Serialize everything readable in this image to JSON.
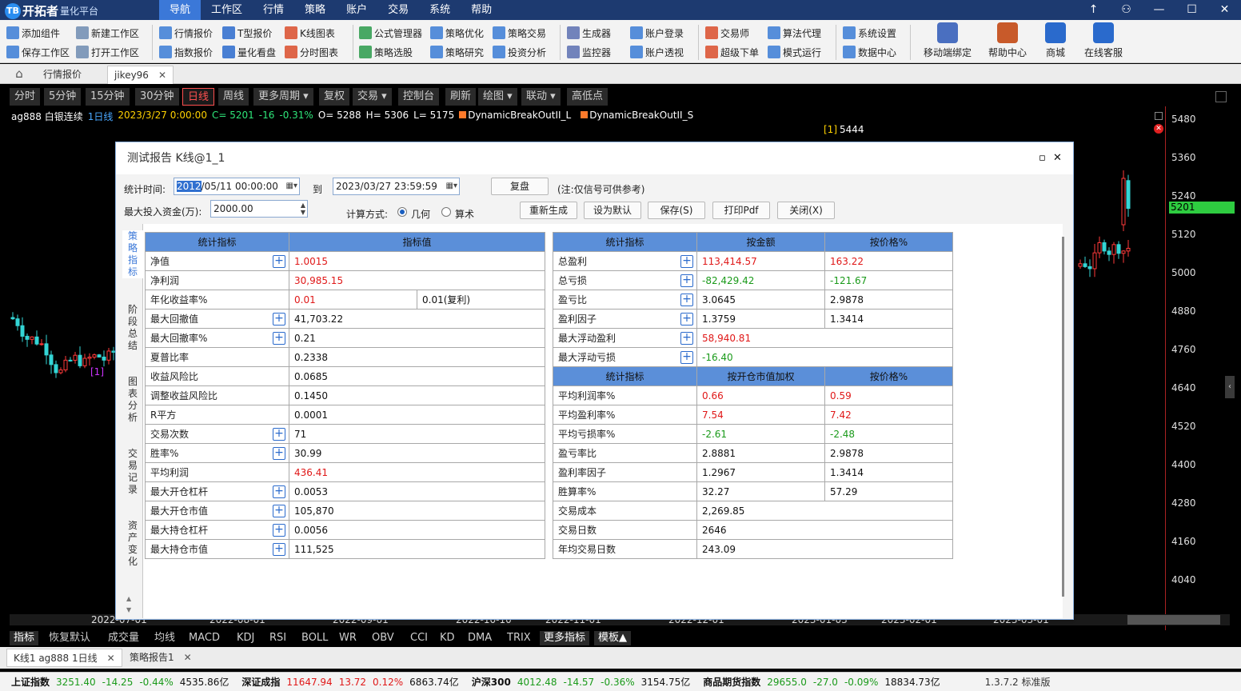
{
  "app": {
    "logo_text": "开拓者",
    "logo_sub": "量化平台",
    "logo_badge": "TB",
    "menu": [
      "导航",
      "工作区",
      "行情",
      "策略",
      "账户",
      "交易",
      "系统",
      "帮助"
    ],
    "menu_active": 0,
    "window_controls": [
      "↑",
      "⚇",
      "—",
      "☐",
      "✕"
    ]
  },
  "toolbar": {
    "groups": [
      [
        "添加组件",
        "保存工作区"
      ],
      [
        "新建工作区",
        "打开工作区"
      ],
      [
        "行情报价",
        "指数报价"
      ],
      [
        "T型报价",
        "量化看盘"
      ],
      [
        "K线图表",
        "分时图表"
      ],
      [
        "公式管理器",
        "策略选股"
      ],
      [
        "策略优化",
        "策略研究"
      ],
      [
        "策略交易",
        "投资分析"
      ],
      [
        "生成器",
        "监控器"
      ],
      [
        "账户登录",
        "账户透视"
      ],
      [
        "交易师",
        "超级下单"
      ],
      [
        "算法代理",
        "模式运行"
      ],
      [
        "系统设置",
        "数据中心"
      ]
    ],
    "big": [
      "移动端绑定",
      "帮助中心",
      "商城",
      "在线客服"
    ]
  },
  "tabs": [
    {
      "label": "行情报价"
    },
    {
      "label": "jikey96",
      "close": "✕"
    }
  ],
  "periods": [
    "分时",
    "5分钟",
    "15分钟",
    "30分钟",
    "日线",
    "周线",
    "更多周期 ▾",
    "复权",
    "交易 ▾",
    "控制台",
    "刷新",
    "绘图 ▾",
    "联动 ▾",
    "高低点"
  ],
  "period_selected": 4,
  "chart": {
    "symbol": "ag888 白银连续",
    "period": "1日线",
    "date": "2023/3/27 0:00:00",
    "close": "C= 5201",
    "change": "-16",
    "pct": "-0.31%",
    "open": "O= 5288",
    "high": "H= 5306",
    "low": "L= 5175",
    "ind1": "DynamicBreakOutII_L",
    "ind2": "DynamicBreakOutII_S",
    "marker_top": "[1]",
    "marker_top_val": "5444",
    "marker_left": "[1]",
    "price_ticks": [
      "5480",
      "5360",
      "5240",
      "5120",
      "5000",
      "4880",
      "4760",
      "4640",
      "4520",
      "4400",
      "4280",
      "4160",
      "4040"
    ],
    "current_price": "5201",
    "dates": [
      "2022-07-01",
      "2022-08-01",
      "2022-09-01",
      "2022-10-10",
      "2022-11-01",
      "2022-12-01",
      "2023-01-03",
      "2023-02-01",
      "2023-03-01"
    ],
    "colors": {
      "up": "#ff3a3a",
      "down": "#33d6d6",
      "bg": "#000000"
    }
  },
  "dialog": {
    "title": "测试报告 K线@1_1",
    "time_label": "统计时间:",
    "start_hl": "2012",
    "start_rest": "/05/11 00:00:00",
    "to_label": "到",
    "end": "2023/03/27 23:59:59",
    "review_btn": "复盘",
    "note": "(注:仅信号可供参考)",
    "capital_label": "最大投入资金(万):",
    "capital": "2000.00",
    "calc_label": "计算方式:",
    "calc_geo": "几何",
    "calc_arith": "算术",
    "buttons": [
      "重新生成",
      "设为默认",
      "保存(S)",
      "打印Pdf",
      "关闭(X)"
    ],
    "side_tabs": [
      "策\n略\n指\n标",
      "阶\n段\n总\n结",
      "图\n表\n分\n析",
      "交\n易\n记\n录",
      "资\n产\n变\n化"
    ],
    "side_tab_active": 0,
    "left_table": {
      "headers": [
        "统计指标",
        "指标值"
      ],
      "rows": [
        {
          "name": "净值",
          "plus": true,
          "value": "1.0015",
          "color": "red"
        },
        {
          "name": "净利润",
          "plus": false,
          "value": "30,985.15",
          "color": "red"
        },
        {
          "name": "年化收益率%",
          "plus": false,
          "value": "0.01",
          "color": "red",
          "value2": "0.01(复利)"
        },
        {
          "name": "最大回撤值",
          "plus": true,
          "value": "41,703.22",
          "color": "blk"
        },
        {
          "name": "最大回撤率%",
          "plus": true,
          "value": "0.21",
          "color": "blk"
        },
        {
          "name": "夏普比率",
          "plus": false,
          "value": "0.2338",
          "color": "blk"
        },
        {
          "name": "收益风险比",
          "plus": false,
          "value": "0.0685",
          "color": "blk"
        },
        {
          "name": "调整收益风险比",
          "plus": false,
          "value": "0.1450",
          "color": "blk"
        },
        {
          "name": "R平方",
          "plus": false,
          "value": "0.0001",
          "color": "blk"
        },
        {
          "name": "交易次数",
          "plus": true,
          "value": "71",
          "color": "blk"
        },
        {
          "name": "胜率%",
          "plus": true,
          "value": "30.99",
          "color": "blk"
        },
        {
          "name": "平均利润",
          "plus": false,
          "value": "436.41",
          "color": "red"
        },
        {
          "name": "最大开仓杠杆",
          "plus": true,
          "value": "0.0053",
          "color": "blk"
        },
        {
          "name": "最大开仓市值",
          "plus": true,
          "value": "105,870",
          "color": "blk"
        },
        {
          "name": "最大持仓杠杆",
          "plus": true,
          "value": "0.0056",
          "color": "blk"
        },
        {
          "name": "最大持仓市值",
          "plus": true,
          "value": "111,525",
          "color": "blk"
        }
      ]
    },
    "right_table1": {
      "headers": [
        "统计指标",
        "按金额",
        "按价格%"
      ],
      "rows": [
        {
          "name": "总盈利",
          "plus": true,
          "v1": "113,414.57",
          "c1": "red",
          "v2": "163.22",
          "c2": "red"
        },
        {
          "name": "总亏损",
          "plus": true,
          "v1": "-82,429.42",
          "c1": "green",
          "v2": "-121.67",
          "c2": "green"
        },
        {
          "name": "盈亏比",
          "plus": true,
          "v1": "3.0645",
          "c1": "blk",
          "v2": "2.9878",
          "c2": "blk"
        },
        {
          "name": "盈利因子",
          "plus": true,
          "v1": "1.3759",
          "c1": "blk",
          "v2": "1.3414",
          "c2": "blk"
        },
        {
          "name": "最大浮动盈利",
          "plus": true,
          "v1": "58,940.81",
          "c1": "red",
          "v2": "",
          "c2": "blk"
        },
        {
          "name": "最大浮动亏损",
          "plus": true,
          "v1": "-16.40",
          "c1": "green",
          "v2": "",
          "c2": "blk"
        }
      ]
    },
    "right_table2": {
      "headers": [
        "统计指标",
        "按开仓市值加权",
        "按价格%"
      ],
      "rows": [
        {
          "name": "平均利润率%",
          "v1": "0.66",
          "c1": "red",
          "v2": "0.59",
          "c2": "red"
        },
        {
          "name": "平均盈利率%",
          "v1": "7.54",
          "c1": "red",
          "v2": "7.42",
          "c2": "red"
        },
        {
          "name": "平均亏损率%",
          "v1": "-2.61",
          "c1": "green",
          "v2": "-2.48",
          "c2": "green"
        },
        {
          "name": "盈亏率比",
          "v1": "2.8881",
          "c1": "blk",
          "v2": "2.9878",
          "c2": "blk"
        },
        {
          "name": "盈利率因子",
          "v1": "1.2967",
          "c1": "blk",
          "v2": "1.3414",
          "c2": "blk"
        },
        {
          "name": "胜算率%",
          "v1": "32.27",
          "c1": "blk",
          "v2": "57.29",
          "c2": "blk"
        },
        {
          "name": "交易成本",
          "v1": "2,269.85",
          "c1": "blk",
          "v2": "",
          "c2": "blk"
        },
        {
          "name": "交易日数",
          "v1": "2646",
          "c1": "blk",
          "v2": "",
          "c2": "blk"
        },
        {
          "name": "年均交易日数",
          "v1": "243.09",
          "c1": "blk",
          "v2": "",
          "c2": "blk"
        }
      ]
    }
  },
  "indicators": [
    "指标",
    "恢复默认",
    "成交量",
    "均线",
    "MACD",
    "KDJ",
    "RSI",
    "BOLL",
    "WR",
    "OBV",
    "CCI",
    "KD",
    "DMA",
    "TRIX",
    "更多指标",
    "模板▲"
  ],
  "bottom_tabs": [
    {
      "label": "K线1 ag888 1日线",
      "close": "✕"
    },
    {
      "label": "策略报告1",
      "close": "✕"
    }
  ],
  "status": {
    "items": [
      {
        "name": "上证指数",
        "price": "3251.40",
        "chg": "-14.25",
        "pct": "-0.44%",
        "amt": "4535.86亿",
        "dir": "green"
      },
      {
        "name": "深证成指",
        "price": "11647.94",
        "chg": "13.72",
        "pct": "0.12%",
        "amt": "6863.74亿",
        "dir": "red"
      },
      {
        "name": "沪深300",
        "price": "4012.48",
        "chg": "-14.57",
        "pct": "-0.36%",
        "amt": "3154.75亿",
        "dir": "green"
      },
      {
        "name": "商品期货指数",
        "price": "29655.0",
        "chg": "-27.0",
        "pct": "-0.09%",
        "amt": "18834.73亿",
        "dir": "green"
      }
    ],
    "version": "1.3.7.2 标准版"
  }
}
